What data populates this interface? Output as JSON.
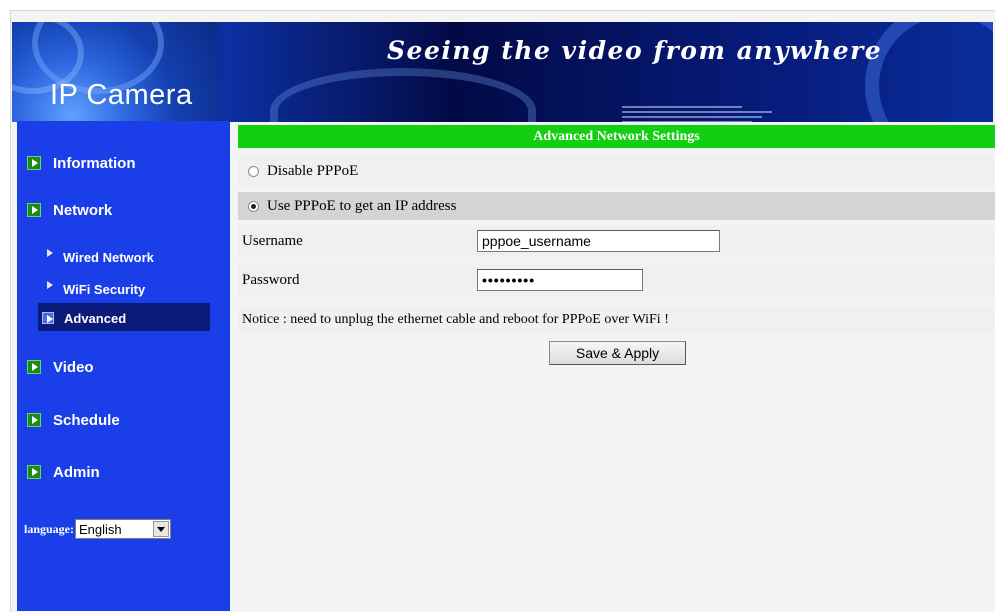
{
  "banner": {
    "title": "IP Camera",
    "slogan": "Seeing the video from anywhere"
  },
  "sidebar": {
    "items": [
      {
        "label": "Information",
        "icon": "green-play-icon"
      },
      {
        "label": "Network",
        "icon": "green-play-icon"
      },
      {
        "label": "Video",
        "icon": "green-play-icon"
      },
      {
        "label": "Schedule",
        "icon": "green-play-icon"
      },
      {
        "label": "Admin",
        "icon": "green-play-icon"
      }
    ],
    "network_sub": [
      {
        "label": "Wired Network",
        "icon": "arrow-right-icon"
      },
      {
        "label": "WiFi Security",
        "icon": "arrow-right-icon"
      },
      {
        "label": "Advanced",
        "icon": "arrow-right-icon",
        "active": true
      }
    ],
    "language_label": "language:",
    "language_value": "English"
  },
  "main": {
    "header": "Advanced Network Settings",
    "option_disable": "Disable PPPoE",
    "option_use": "Use PPPoE to get an IP address",
    "selected_option": "use",
    "username_label": "Username",
    "username_value": "pppoe_username",
    "password_label": "Password",
    "password_value": "•••••••••",
    "notice": "Notice : need to unplug the ethernet cable and reboot for PPPoE over WiFi !",
    "save_label": "Save & Apply"
  },
  "colors": {
    "sidebar_bg": "#1a3fe8",
    "header_bg": "#12cf12",
    "active_sub_bg": "#0a1b7a"
  }
}
